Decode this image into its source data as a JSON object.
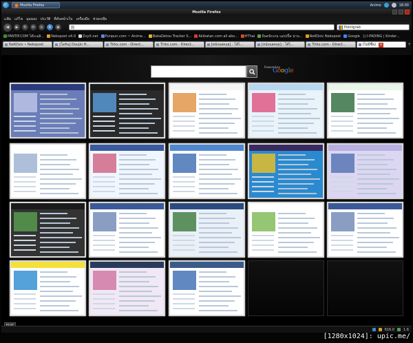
{
  "os_panel": {
    "task_label": "Mozilla Firefox",
    "tray_user": "Anime",
    "time": "18:00"
  },
  "window": {
    "title": "Mozilla Firefox"
  },
  "menu": [
    "แฟ้ม",
    "แก้ไข",
    "มุมมอง",
    "ประวัติ",
    "ที่คั่นหน้าเว็บ",
    "เครื่องมือ",
    "ช่วยเหลือ"
  ],
  "search_engine": {
    "value": "Pointgrab"
  },
  "bookmarks": [
    {
      "label": "PANTIP.COM โต๊ะเฉลิ...",
      "color": "#3c8f2a"
    },
    {
      "label": "Nekopost v4.0",
      "color": "#e0a020"
    },
    {
      "label": "ZvyX.net",
      "color": "#ddd"
    },
    {
      "label": "Punpun.com ~ Anime...",
      "color": "#5a8ad8"
    },
    {
      "label": "BakaDetou Tracker S...",
      "color": "#e2b030"
    },
    {
      "label": "Akibatan.com all abo...",
      "color": "#d04030"
    },
    {
      "label": "HThai",
      "color": "#d05020"
    },
    {
      "label": "ปั่นคนิกเกม แอปเปิ้ล น่าน...",
      "color": "#60a040"
    },
    {
      "label": "NeKOsiv Nekopost",
      "color": "#e0a020"
    },
    {
      "label": "Google",
      "color": "#4285f4"
    },
    {
      "label": "I-PADING | Kinder...",
      "color": "#333"
    }
  ],
  "tabs": [
    {
      "label": "NeKOsiv • Nekopost",
      "active": false
    },
    {
      "label": "[โดจิน] Doujin H...",
      "active": false
    },
    {
      "label": "Tirkx.com - Direct...",
      "active": false
    },
    {
      "label": "Tirkx.com - Direct...",
      "active": false
    },
    {
      "label": "[หนังนสคฤย] : โด้ไ...",
      "active": false
    },
    {
      "label": "[หนังนสคฤย] : โด้ไ...",
      "active": false
    },
    {
      "label": "Tirkx.com - Direct...",
      "active": false
    },
    {
      "label": "(ไม่มีชื่อ)",
      "active": true
    }
  ],
  "speed_dial": {
    "powered_by": "Powered by",
    "google": "Google",
    "edit_label": "EDIT"
  },
  "thumbnails": [
    {
      "name": "thumb-1",
      "bar": "#2a3a7a",
      "bg": "#6a7db8",
      "accent": "#c0c8e8"
    },
    {
      "name": "thumb-2",
      "bar": "#1a1a1a",
      "bg": "#2a2a2a",
      "accent": "#5aa0e0"
    },
    {
      "name": "thumb-3",
      "bar": "#f5f5f5",
      "bg": "#ffffff",
      "accent": "#e09040"
    },
    {
      "name": "thumb-4",
      "bar": "#b8d8f0",
      "bg": "#e8f3fa",
      "accent": "#e05080"
    },
    {
      "name": "thumb-5",
      "bar": "#e8f5e8",
      "bg": "#ffffff",
      "accent": "#2a6a3a"
    },
    {
      "name": "thumb-6",
      "bar": "#ffffff",
      "bg": "#ffffff",
      "accent": "#9ab0d0"
    },
    {
      "name": "thumb-7",
      "bar": "#3a5aa0",
      "bg": "#f0f6ff",
      "accent": "#d06080"
    },
    {
      "name": "thumb-8",
      "bar": "#5088d0",
      "bg": "#ffffff",
      "accent": "#3a6ab0"
    },
    {
      "name": "thumb-9",
      "bar": "#3a2a60",
      "bg": "#2a8ad0",
      "accent": "#f0c020"
    },
    {
      "name": "thumb-10",
      "bar": "#b8b0e0",
      "bg": "#dcd6f2",
      "accent": "#5070b0"
    },
    {
      "name": "thumb-11",
      "bar": "#1a1a1a",
      "bg": "#333333",
      "accent": "#5aa050"
    },
    {
      "name": "thumb-12",
      "bar": "#3b5998",
      "bg": "#ffffff",
      "accent": "#6d84b4"
    },
    {
      "name": "thumb-13",
      "bar": "#2a4a80",
      "bg": "#eaf0f8",
      "accent": "#3a7a3a"
    },
    {
      "name": "thumb-14",
      "bar": "#ffffff",
      "bg": "#ffffff",
      "accent": "#7ab850"
    },
    {
      "name": "thumb-15",
      "bar": "#3b5998",
      "bg": "#ffffff",
      "accent": "#6d84b4"
    },
    {
      "name": "thumb-16",
      "bar": "#f4e03a",
      "bg": "#ffffff",
      "accent": "#2a8ad0"
    },
    {
      "name": "thumb-17",
      "bar": "#2a3a5a",
      "bg": "#f0e8f4",
      "accent": "#d070a0"
    },
    {
      "name": "thumb-18",
      "bar": "#3a5a8a",
      "bg": "#ffffff",
      "accent": "#3a6ab0"
    }
  ],
  "statusbar": {
    "value": "616.0",
    "percent": "1.6"
  },
  "watermark": "[1280x1024]: upic.me/"
}
